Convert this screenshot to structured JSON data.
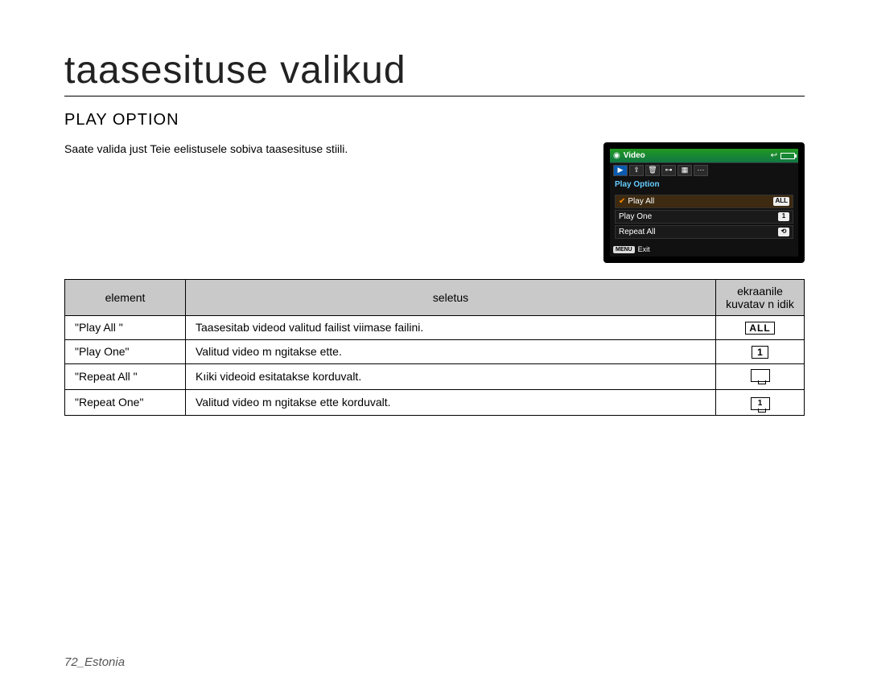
{
  "title": "taasesituse valikud",
  "heading": "PLAY OPTION",
  "intro": "Saate valida just Teie eelistusele sobiva taasesituse stiili.",
  "device": {
    "header_title": "Video",
    "menu_title": "Play Option",
    "items": [
      {
        "label": "Play All",
        "badge": "ALL",
        "active": true
      },
      {
        "label": "Play One",
        "badge": "1",
        "active": false
      },
      {
        "label": "Repeat All",
        "badge": "⟲",
        "active": false
      }
    ],
    "footer_menu": "MENU",
    "footer_exit": "Exit"
  },
  "table": {
    "headers": {
      "element": "element",
      "seletus": "seletus",
      "indicator": "ekraanile kuvatav n idik"
    },
    "rows": [
      {
        "name": "\"Play All \"",
        "desc": "Taasesitab videod valitud failist viimase failini.",
        "icon": "ALL"
      },
      {
        "name": "\"Play One\"",
        "desc": "Valitud video m ngitakse ette.",
        "icon": "1"
      },
      {
        "name": "\"Repeat All \"",
        "desc": "Kıiki videoid esitatakse korduvalt.",
        "icon": ""
      },
      {
        "name": "\"Repeat One\"",
        "desc": "Valitud video m ngitakse ette korduvalt.",
        "icon": "1"
      }
    ]
  },
  "footer": "72_Estonia"
}
